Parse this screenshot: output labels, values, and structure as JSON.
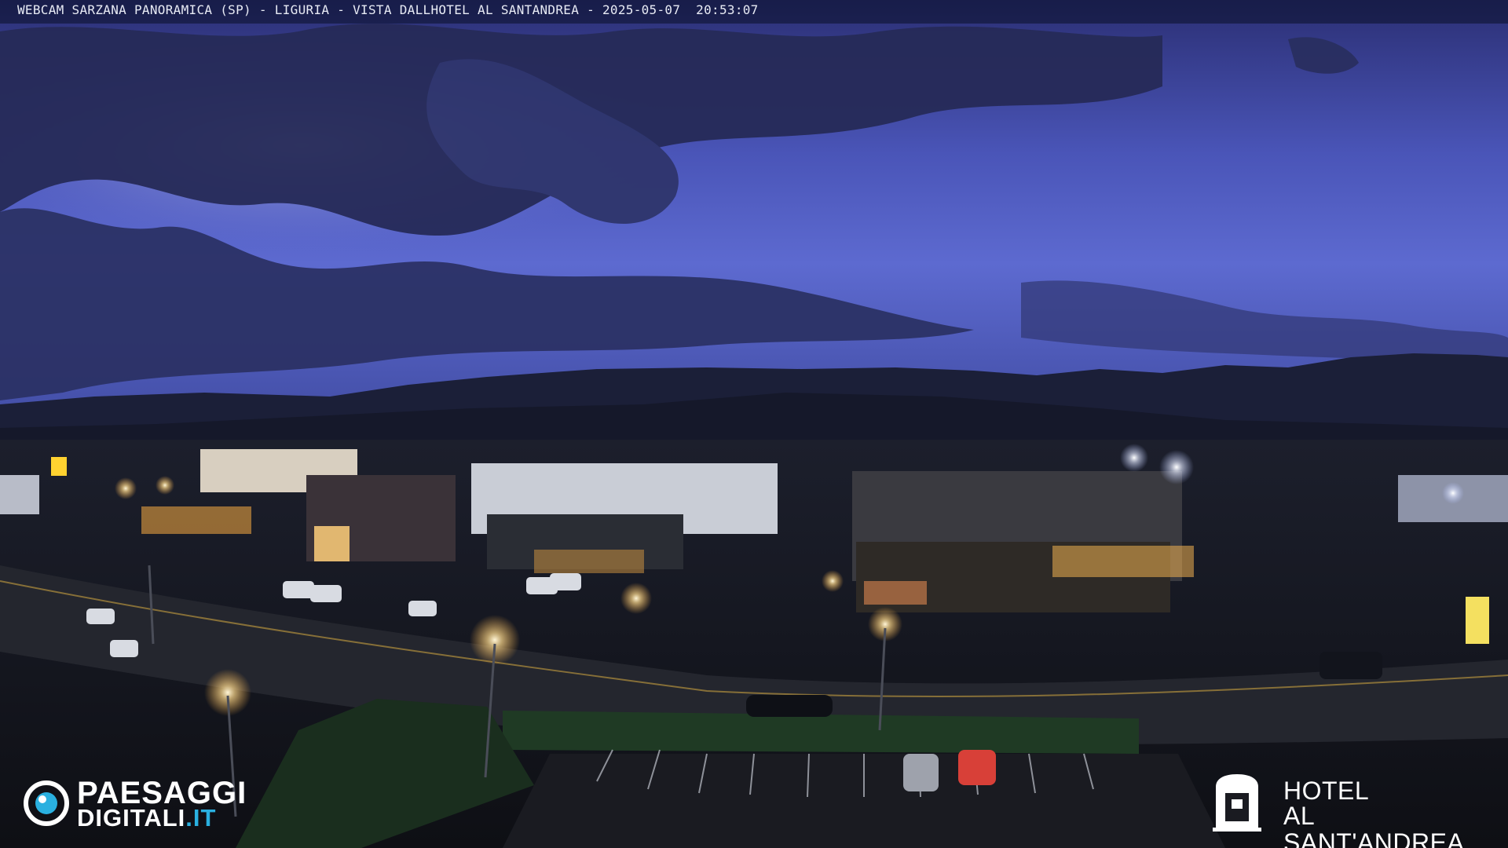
{
  "caption": {
    "text": "WEBCAM SARZANA PANORAMICA (SP) - LIGURIA - VISTA DALLHOTEL AL SANTANDREA - 2025-05-07  20:53:07"
  },
  "watermark_left": {
    "line1": "PAESAGGI",
    "line2_main": "DIGITALI",
    "line2_accent": ".IT",
    "accent_color": "#2ab0e0"
  },
  "watermark_right": {
    "line1": "HOTEL",
    "line2": "AL SANT'ANDREA",
    "icon": "hotel-building-emblem-icon"
  },
  "colors": {
    "sky_top": "#2a3278",
    "sky_mid": "#5664c8",
    "clouds": "#2a2f5c",
    "mountains": "#1a1e33",
    "ground": "#14161c"
  }
}
